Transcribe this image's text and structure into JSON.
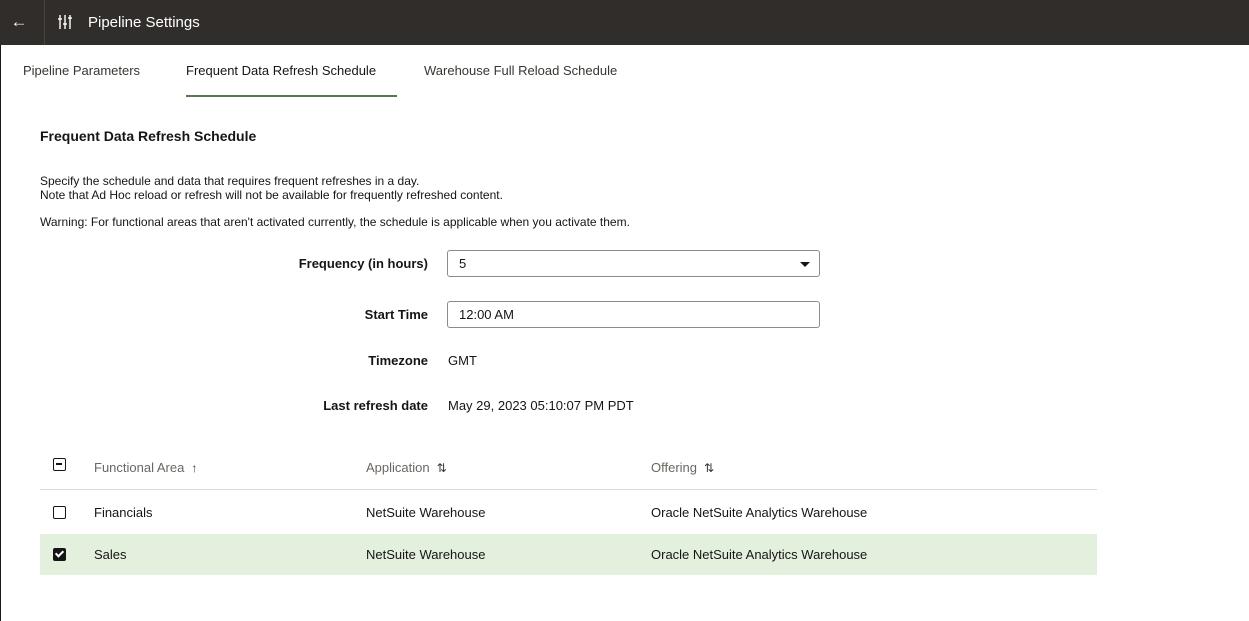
{
  "header": {
    "back_glyph": "←",
    "back_icon": "arrow-left-icon",
    "settings_icon": "sliders-icon",
    "title": "Pipeline Settings"
  },
  "tabs": [
    {
      "label": "Pipeline Parameters",
      "active": false
    },
    {
      "label": "Frequent Data Refresh Schedule",
      "active": true
    },
    {
      "label": "Warehouse Full Reload Schedule",
      "active": false
    }
  ],
  "section": {
    "title": "Frequent Data Refresh Schedule",
    "desc_line_1": "Specify the schedule and data that requires frequent refreshes in a day.",
    "desc_line_2": "Note that Ad Hoc reload or refresh will not be available for frequently refreshed content.",
    "warning": "Warning: For functional areas that aren't activated currently, the schedule is applicable when you activate them."
  },
  "form": {
    "frequency_label": "Frequency (in hours)",
    "frequency_value": "5",
    "start_time_label": "Start Time",
    "start_time_value": "12:00 AM",
    "timezone_label": "Timezone",
    "timezone_value": "GMT",
    "last_refresh_label": "Last refresh date",
    "last_refresh_value": "May 29, 2023 05:10:07 PM PDT"
  },
  "table": {
    "columns": [
      {
        "label": "Functional Area",
        "sort_glyph": "↑"
      },
      {
        "label": "Application",
        "sort_glyph": "⇅"
      },
      {
        "label": "Offering",
        "sort_glyph": "⇅"
      }
    ],
    "rows": [
      {
        "functional_area": "Financials",
        "application": "NetSuite Warehouse",
        "offering": "Oracle NetSuite Analytics Warehouse",
        "checked": false
      },
      {
        "functional_area": "Sales",
        "application": "NetSuite Warehouse",
        "offering": "Oracle NetSuite Analytics Warehouse",
        "checked": true
      }
    ]
  },
  "colors": {
    "header_bg": "#312d2a",
    "tab_indicator": "#547c4a",
    "selected_row_bg": "#e3f0de"
  }
}
